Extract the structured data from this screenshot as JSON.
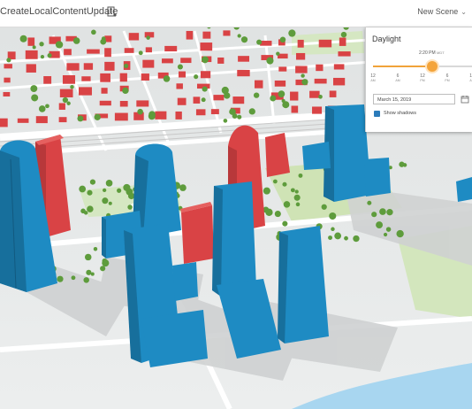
{
  "header": {
    "title": "CreateLocalContentUpdate",
    "title_icon": "building-person-icon",
    "scene_menu_label": "New Scene",
    "scene_menu_icon": "chevron-down-icon"
  },
  "daylight": {
    "title": "Daylight",
    "time_label": "2:20 PM",
    "time_zone": "MDT",
    "time_fraction": 0.597,
    "ticks": [
      {
        "value": "12",
        "suffix": "AM"
      },
      {
        "value": "6",
        "suffix": "AM"
      },
      {
        "value": "12",
        "suffix": "PM"
      },
      {
        "value": "6",
        "suffix": "PM"
      },
      {
        "value": "12",
        "suffix": "AM"
      }
    ],
    "date_value": "March 15, 2019",
    "calendar_icon": "calendar-icon",
    "show_shadows_label": "Show shadows",
    "show_shadows_checked": true
  },
  "colors": {
    "tall_building": "#1e8bc3",
    "short_building": "#d94345",
    "ground": "#e9ebeb",
    "park": "#cfe3b5",
    "tree": "#5e9c3c",
    "water": "#a8d6f0",
    "accent": "#2b7bba"
  }
}
